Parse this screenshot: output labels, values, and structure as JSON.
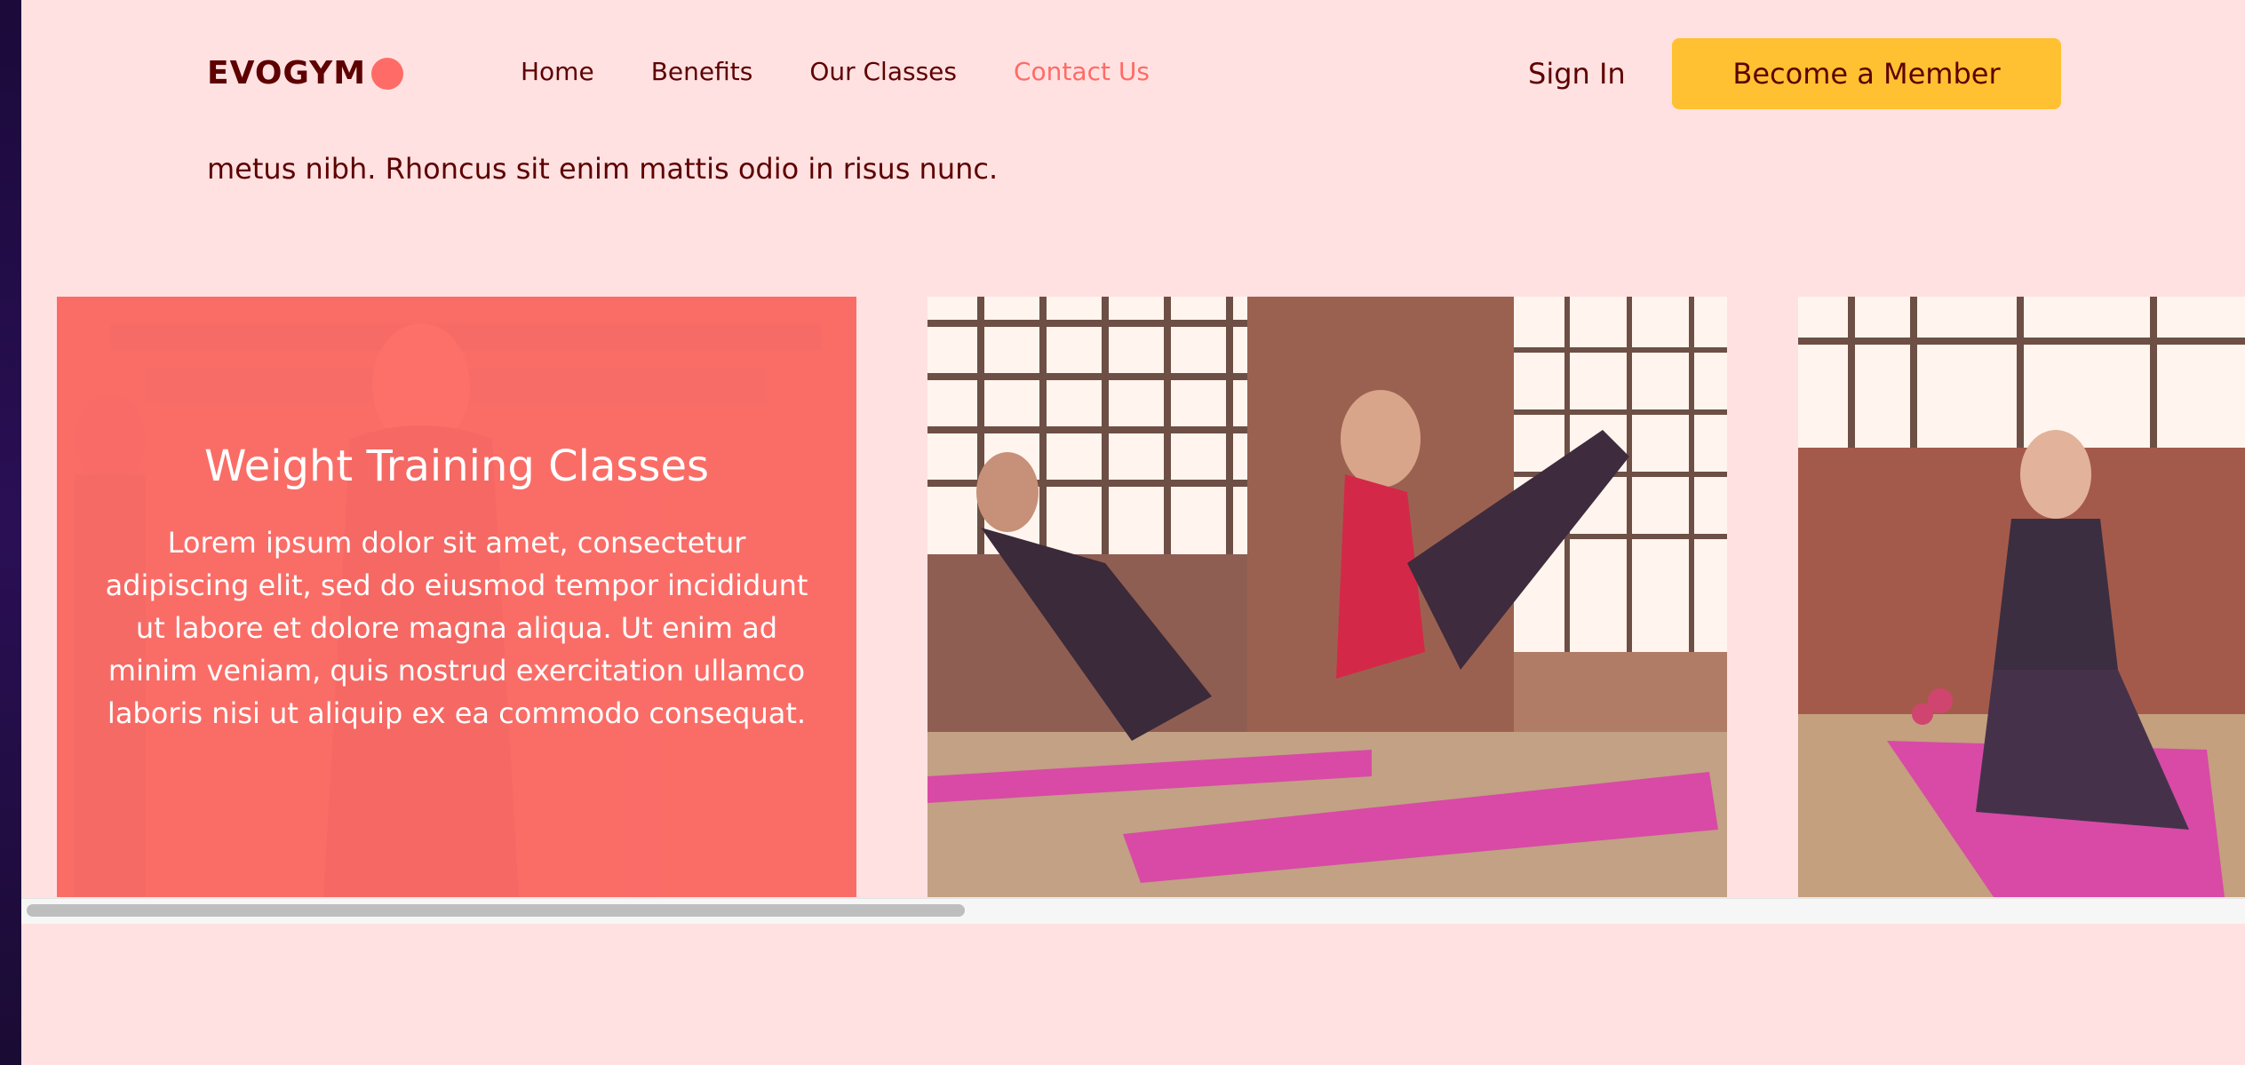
{
  "brand": {
    "logo_text": "EVOGYM",
    "accent": "#FF6B66",
    "primary_text": "#5E0000",
    "cta_color": "#FFC132",
    "background": "#FFE1E1"
  },
  "nav": {
    "links": [
      "Home",
      "Benefits",
      "Our Classes",
      "Contact Us"
    ],
    "active": "Contact Us",
    "sign_in": "Sign In",
    "cta": "Become a Member"
  },
  "intro_text": "metus nibh. Rhoncus sit enim mattis odio in risus nunc.",
  "classes": [
    {
      "title": "Weight Training Classes",
      "description": "Lorem ipsum dolor sit amet, consectetur adipiscing elit, sed do eiusmod tempor incididunt ut labore et dolore magna aliqua. Ut enim ad minim veniam, quis nostrud exercitation ullamco laboris nisi ut aliquip ex ea commodo consequat.",
      "image": "weight-training-photo"
    },
    {
      "image": "yoga-class-photo"
    },
    {
      "image": "fitness-class-photo"
    }
  ]
}
